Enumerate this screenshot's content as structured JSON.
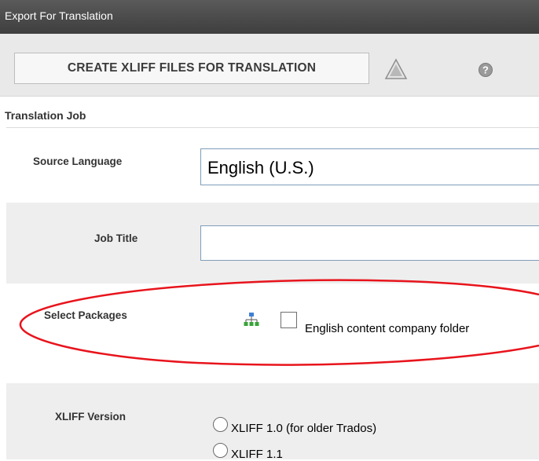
{
  "window": {
    "title": "Export For Translation"
  },
  "toolbar": {
    "create_label": "CREATE XLIFF FILES FOR TRANSLATION"
  },
  "section": {
    "title": "Translation Job"
  },
  "form": {
    "source_language": {
      "label": "Source Language",
      "value": "English (U.S.)"
    },
    "job_title": {
      "label": "Job Title",
      "value": ""
    },
    "packages": {
      "label": "Select Packages",
      "items": [
        {
          "label": "English content company folder",
          "checked": false
        }
      ]
    },
    "xliff_version": {
      "label": "XLIFF Version",
      "options": [
        {
          "label": "XLIFF 1.0 (for older Trados)",
          "selected": false
        },
        {
          "label": "XLIFF 1.1",
          "selected": false
        }
      ]
    }
  },
  "annotation": {
    "color": "#e8141c"
  }
}
